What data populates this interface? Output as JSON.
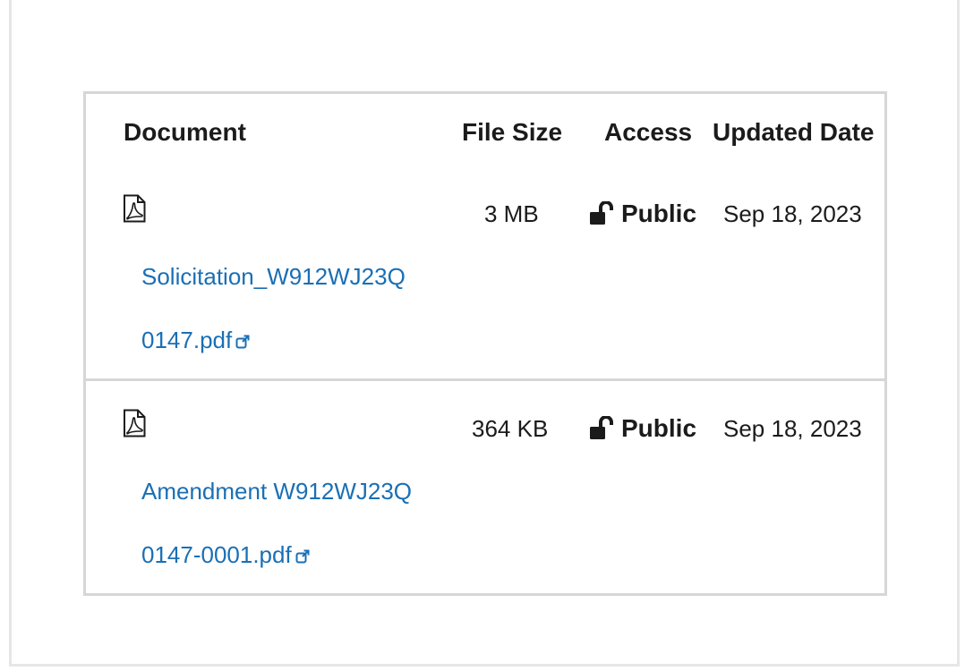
{
  "table": {
    "headers": {
      "document": "Document",
      "file_size": "File Size",
      "access": "Access",
      "updated_date": "Updated Date"
    },
    "rows": [
      {
        "file_icon": "pdf-file-icon",
        "name_line1": "Solicitation_W912WJ23Q",
        "name_line2": "0147.pdf",
        "link_icon": "external-link-icon",
        "file_size": "3 MB",
        "access_icon": "unlock-icon",
        "access": "Public",
        "updated_date": "Sep 18, 2023"
      },
      {
        "file_icon": "pdf-file-icon",
        "name_line1": "Amendment W912WJ23Q",
        "name_line2": "0147-0001.pdf",
        "link_icon": "external-link-icon",
        "file_size": "364 KB",
        "access_icon": "unlock-icon",
        "access": "Public",
        "updated_date": "Sep 18, 2023"
      }
    ]
  },
  "colors": {
    "link": "#1a6fb5",
    "text": "#1b1b1b",
    "border": "#d6d6d6"
  }
}
